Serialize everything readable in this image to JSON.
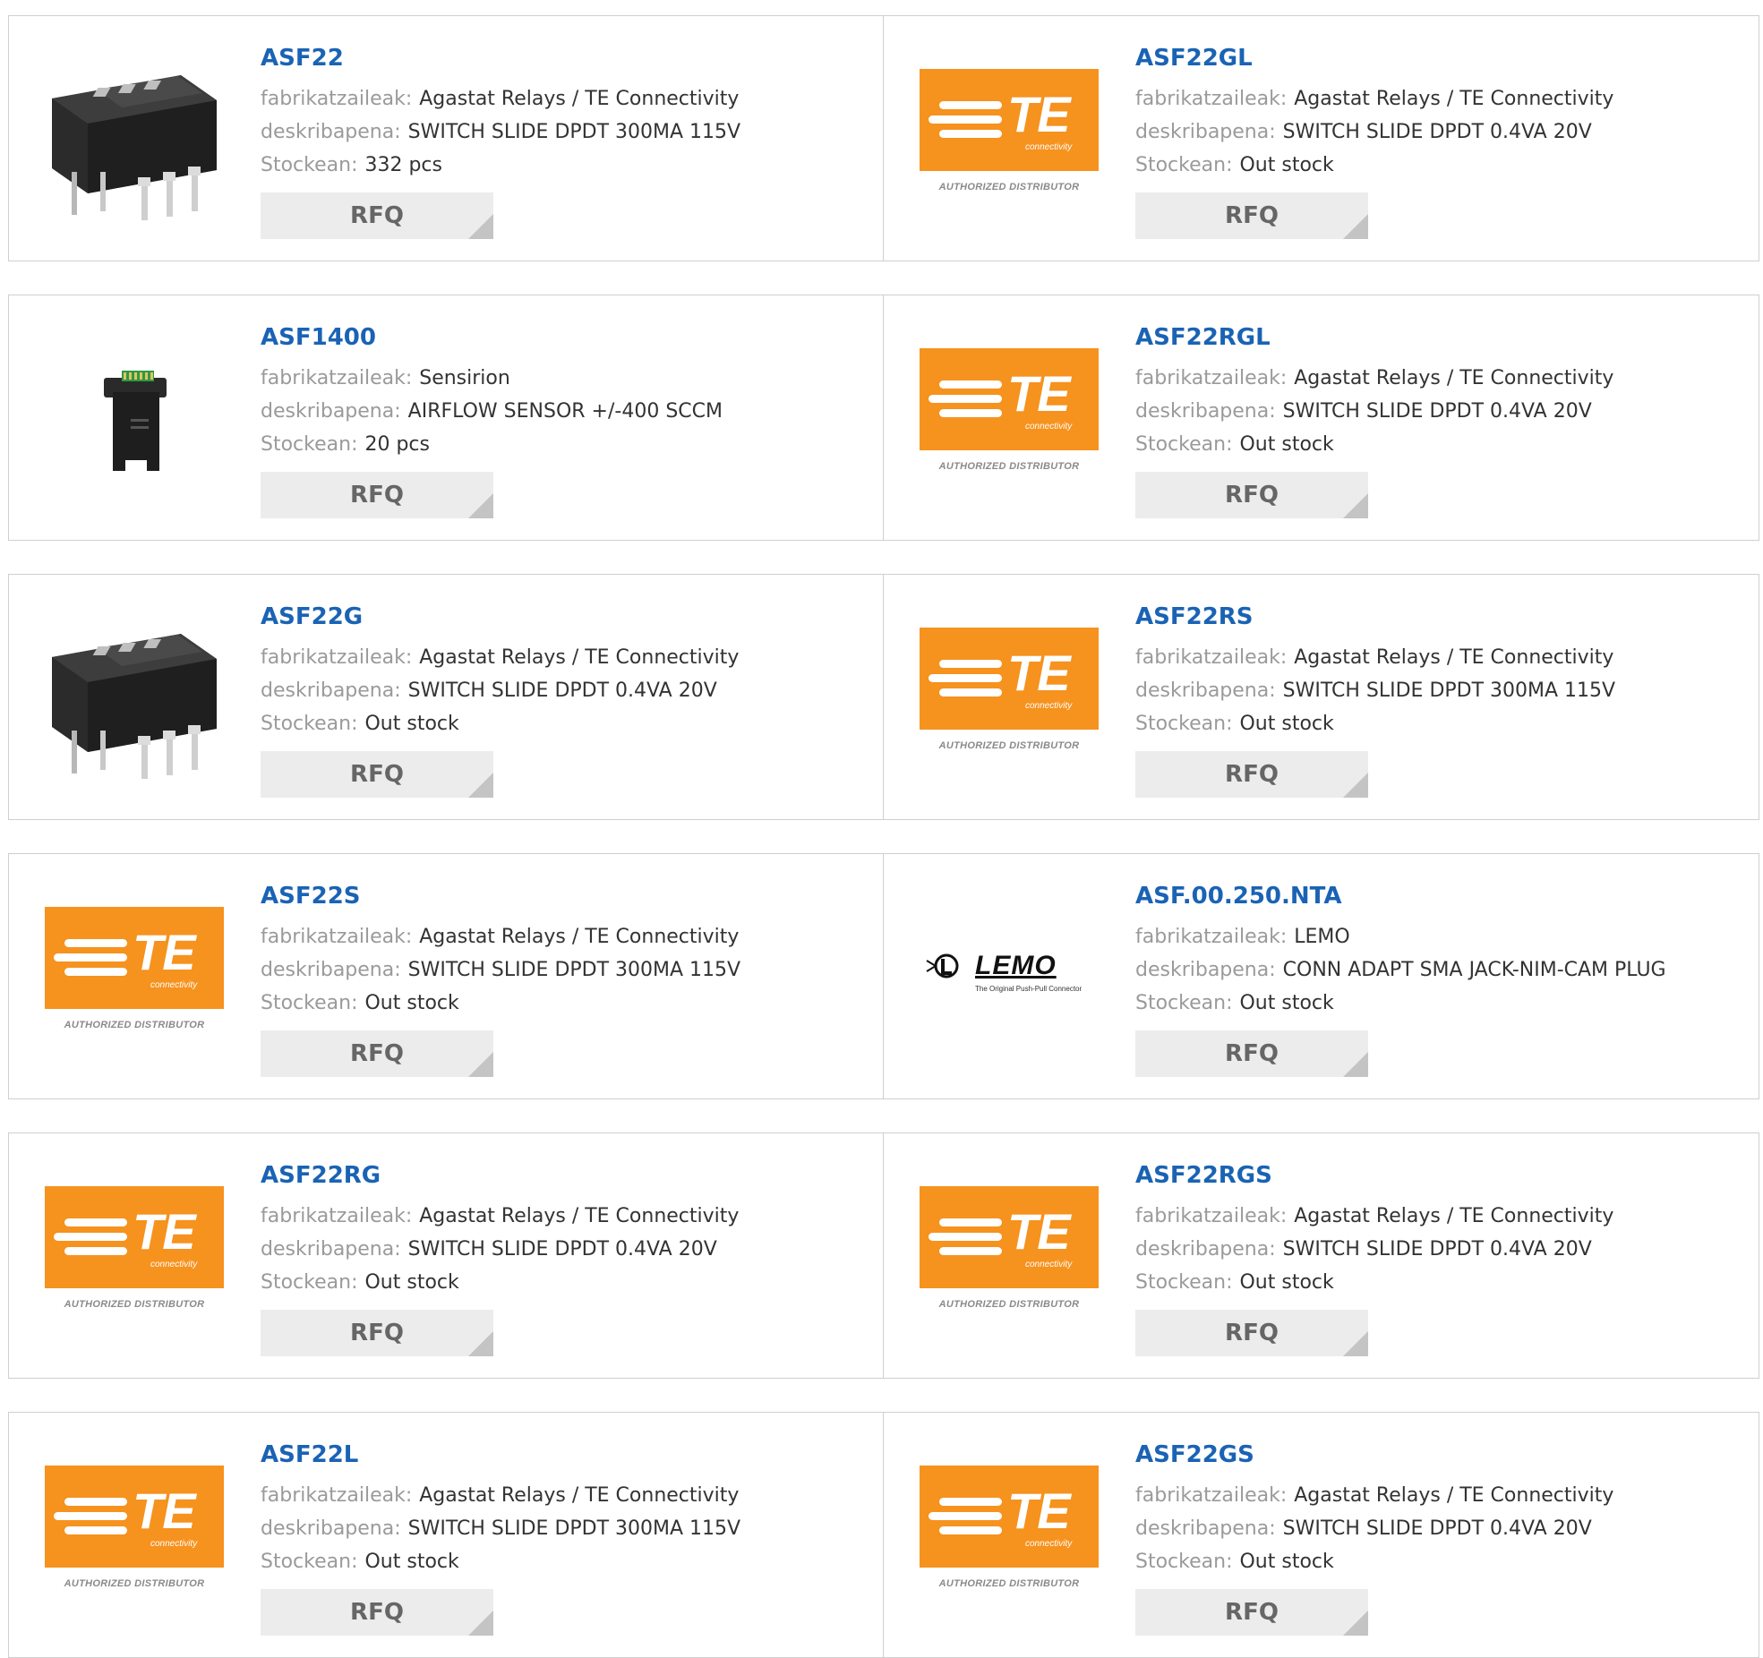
{
  "labels": {
    "manufacturer": "fabrikatzaileak:",
    "description": "deskribapena:",
    "stock": "Stockean:",
    "rfq": "RFQ"
  },
  "logo_texts": {
    "te_word": "TE",
    "te_sub": "connectivity",
    "authorized": "AUTHORIZED DISTRIBUTOR",
    "lemo_word": "LEMO",
    "lemo_tag": "The Original Push-Pull Connector"
  },
  "colors": {
    "part_link": "#1a63b4",
    "te_orange": "#f6921e",
    "rfq_bg": "#ececec"
  },
  "products": [
    {
      "part": "ASF22",
      "manufacturer": "Agastat Relays / TE Connectivity",
      "description": "SWITCH SLIDE DPDT 300MA 115V",
      "stock": "332 pcs",
      "image": "switch-photo"
    },
    {
      "part": "ASF22GL",
      "manufacturer": "Agastat Relays / TE Connectivity",
      "description": "SWITCH SLIDE DPDT 0.4VA 20V",
      "stock": "Out stock",
      "image": "te-logo"
    },
    {
      "part": "ASF1400",
      "manufacturer": "Sensirion",
      "description": "AIRFLOW SENSOR +/-400 SCCM",
      "stock": "20 pcs",
      "image": "sensor-photo"
    },
    {
      "part": "ASF22RGL",
      "manufacturer": "Agastat Relays / TE Connectivity",
      "description": "SWITCH SLIDE DPDT 0.4VA 20V",
      "stock": "Out stock",
      "image": "te-logo"
    },
    {
      "part": "ASF22G",
      "manufacturer": "Agastat Relays / TE Connectivity",
      "description": "SWITCH SLIDE DPDT 0.4VA 20V",
      "stock": "Out stock",
      "image": "switch-photo"
    },
    {
      "part": "ASF22RS",
      "manufacturer": "Agastat Relays / TE Connectivity",
      "description": "SWITCH SLIDE DPDT 300MA 115V",
      "stock": "Out stock",
      "image": "te-logo"
    },
    {
      "part": "ASF22S",
      "manufacturer": "Agastat Relays / TE Connectivity",
      "description": "SWITCH SLIDE DPDT 300MA 115V",
      "stock": "Out stock",
      "image": "te-logo"
    },
    {
      "part": "ASF.00.250.NTA",
      "manufacturer": "LEMO",
      "description": "CONN ADAPT SMA JACK-NIM-CAM PLUG",
      "stock": "Out stock",
      "image": "lemo-logo"
    },
    {
      "part": "ASF22RG",
      "manufacturer": "Agastat Relays / TE Connectivity",
      "description": "SWITCH SLIDE DPDT 0.4VA 20V",
      "stock": "Out stock",
      "image": "te-logo"
    },
    {
      "part": "ASF22RGS",
      "manufacturer": "Agastat Relays / TE Connectivity",
      "description": "SWITCH SLIDE DPDT 0.4VA 20V",
      "stock": "Out stock",
      "image": "te-logo"
    },
    {
      "part": "ASF22L",
      "manufacturer": "Agastat Relays / TE Connectivity",
      "description": "SWITCH SLIDE DPDT 300MA 115V",
      "stock": "Out stock",
      "image": "te-logo"
    },
    {
      "part": "ASF22GS",
      "manufacturer": "Agastat Relays / TE Connectivity",
      "description": "SWITCH SLIDE DPDT 0.4VA 20V",
      "stock": "Out stock",
      "image": "te-logo"
    }
  ]
}
